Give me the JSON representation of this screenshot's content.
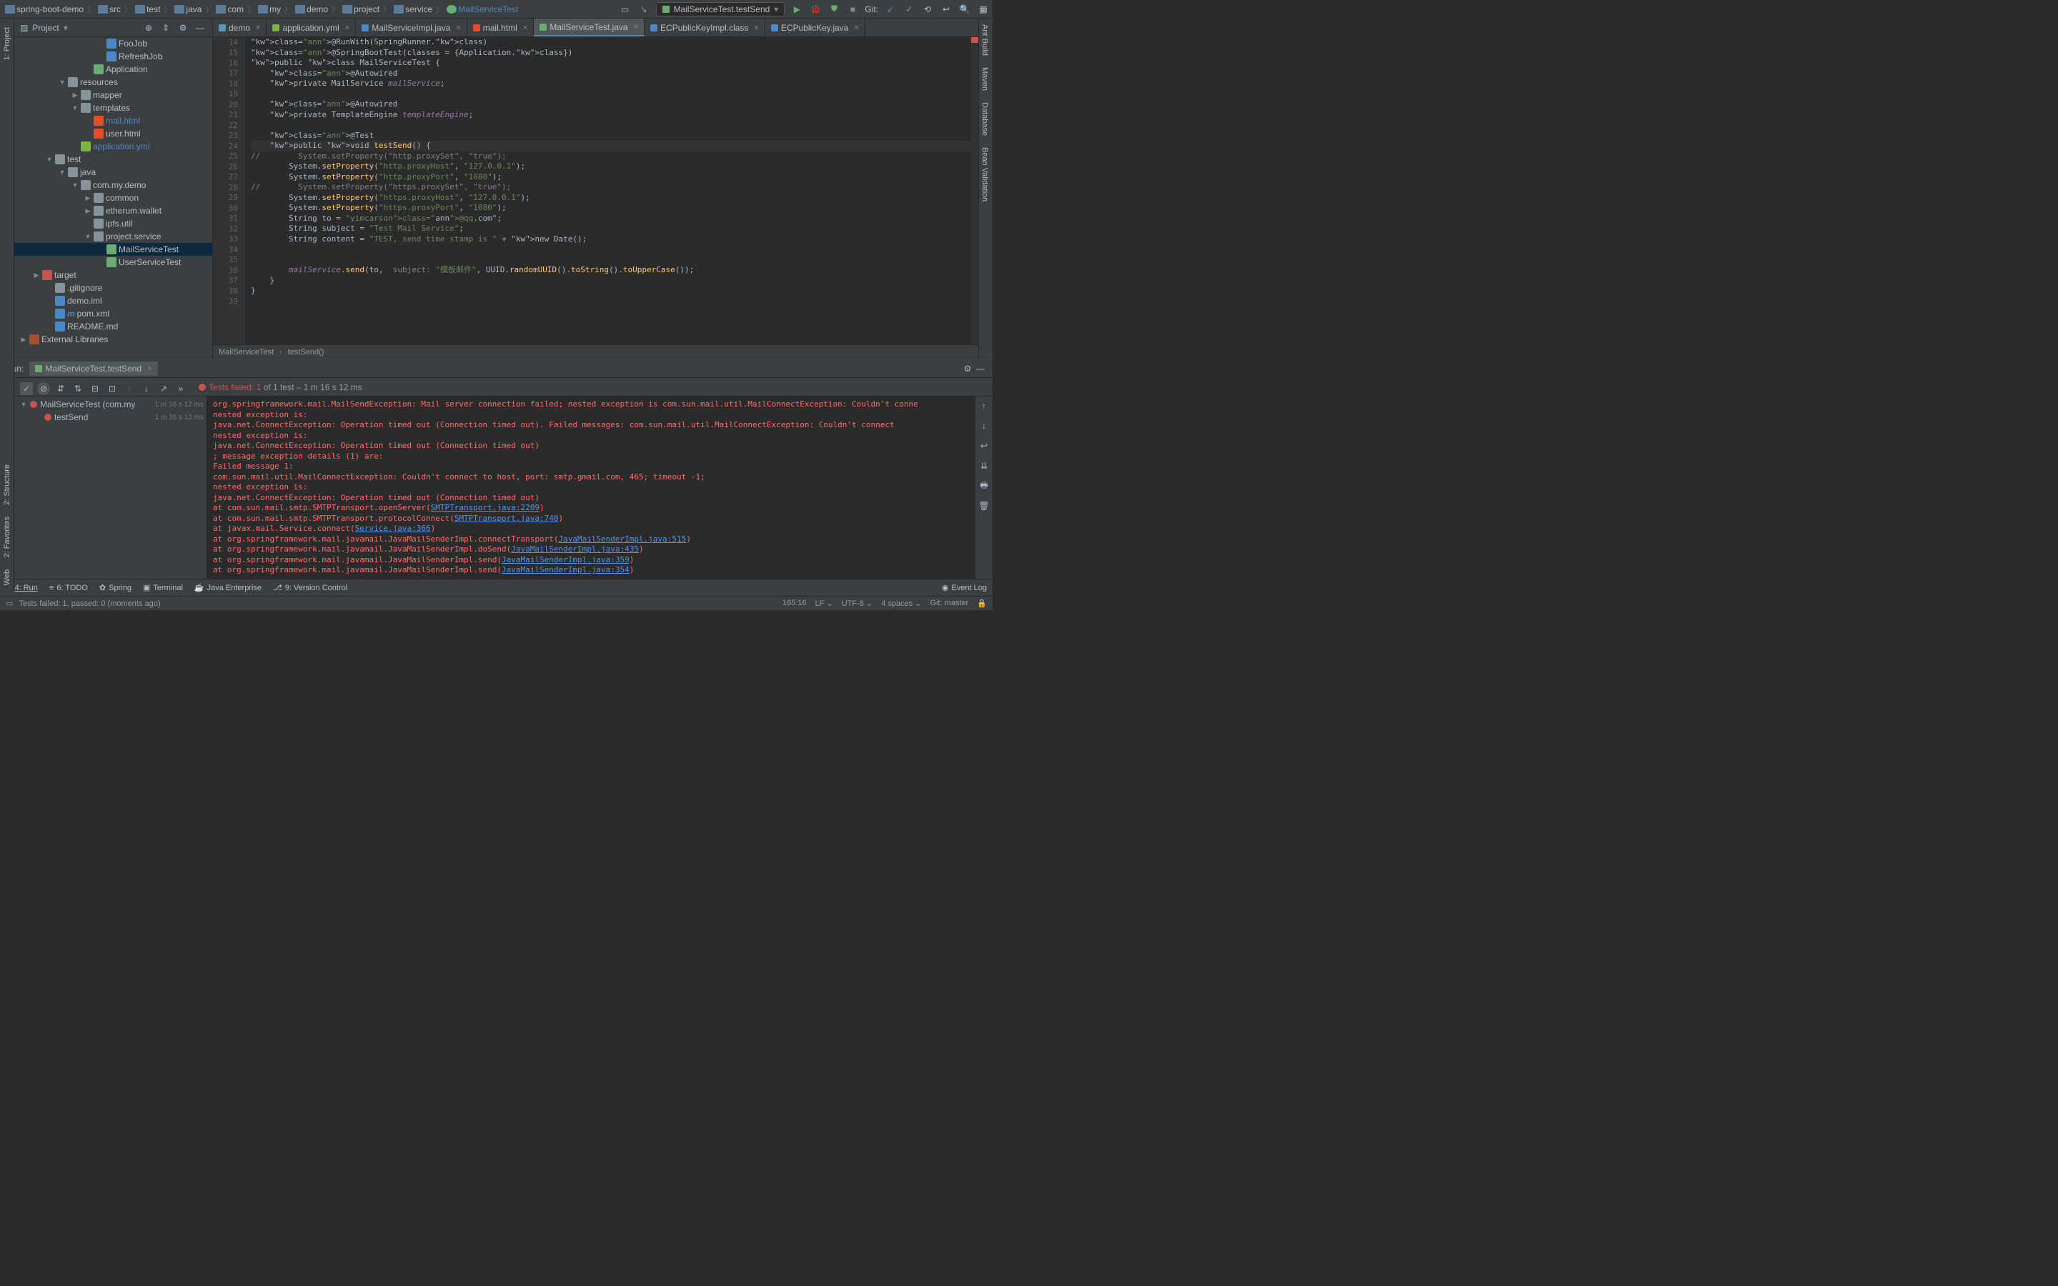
{
  "breadcrumbs": [
    "spring-boot-demo",
    "src",
    "test",
    "java",
    "com",
    "my",
    "demo",
    "project",
    "service",
    "MailServiceTest"
  ],
  "run_config": "MailServiceTest.testSend",
  "git_label": "Git:",
  "editor_tabs": [
    {
      "label": "demo",
      "icon": "#519aba"
    },
    {
      "label": "application.yml",
      "icon": "#7cb342"
    },
    {
      "label": "MailServiceImpl.java",
      "icon": "#4a88c7"
    },
    {
      "label": "mail.html",
      "icon": "#e44d26"
    },
    {
      "label": "MailServiceTest.java",
      "icon": "#6aab73",
      "active": true
    },
    {
      "label": "ECPublicKeyImpl.class",
      "icon": "#4a88c7"
    },
    {
      "label": "ECPublicKey.java",
      "icon": "#4a88c7"
    }
  ],
  "project": {
    "header": "Project",
    "items": [
      {
        "pad": 108,
        "icon": "#4a88c7",
        "label": "FooJob",
        "arr": ""
      },
      {
        "pad": 108,
        "icon": "#4a88c7",
        "label": "RefreshJob",
        "arr": ""
      },
      {
        "pad": 90,
        "icon": "#6aab73",
        "label": "Application",
        "arr": ""
      },
      {
        "pad": 54,
        "icon": "#87939a",
        "label": "resources",
        "arr": "▼"
      },
      {
        "pad": 72,
        "icon": "#87939a",
        "label": "mapper",
        "arr": "▶"
      },
      {
        "pad": 72,
        "icon": "#87939a",
        "label": "templates",
        "arr": "▼"
      },
      {
        "pad": 90,
        "icon": "#e44d26",
        "label": "mail.html",
        "arr": "",
        "color": "#4a88c7"
      },
      {
        "pad": 90,
        "icon": "#e44d26",
        "label": "user.html",
        "arr": ""
      },
      {
        "pad": 72,
        "icon": "#7cb342",
        "label": "application.yml",
        "arr": "",
        "color": "#4a88c7"
      },
      {
        "pad": 36,
        "icon": "#87939a",
        "label": "test",
        "arr": "▼"
      },
      {
        "pad": 54,
        "icon": "#87939a",
        "label": "java",
        "arr": "▼"
      },
      {
        "pad": 72,
        "icon": "#87939a",
        "label": "com.my.demo",
        "arr": "▼"
      },
      {
        "pad": 90,
        "icon": "#87939a",
        "label": "common",
        "arr": "▶"
      },
      {
        "pad": 90,
        "icon": "#87939a",
        "label": "etherum.wallet",
        "arr": "▶"
      },
      {
        "pad": 90,
        "icon": "#87939a",
        "label": "ipfs.util",
        "arr": ""
      },
      {
        "pad": 90,
        "icon": "#87939a",
        "label": "project.service",
        "arr": "▼"
      },
      {
        "pad": 108,
        "icon": "#6aab73",
        "label": "MailServiceTest",
        "arr": "",
        "sel": true
      },
      {
        "pad": 108,
        "icon": "#6aab73",
        "label": "UserServiceTest",
        "arr": ""
      },
      {
        "pad": 18,
        "icon": "#c75450",
        "label": "target",
        "arr": "▶"
      },
      {
        "pad": 36,
        "icon": "#87939a",
        "label": ".gitignore",
        "arr": ""
      },
      {
        "pad": 36,
        "icon": "#4a88c7",
        "label": "demo.iml",
        "arr": ""
      },
      {
        "pad": 36,
        "icon": "#4a88c7",
        "label": "pom.xml",
        "arr": "",
        "pre": "m"
      },
      {
        "pad": 36,
        "icon": "#4a88c7",
        "label": "README.md",
        "arr": ""
      },
      {
        "pad": 0,
        "icon": "#a0522d",
        "label": "External Libraries",
        "arr": "▶"
      }
    ]
  },
  "code": {
    "start": 14,
    "highlight": 24,
    "lines": [
      "@RunWith(SpringRunner.class)",
      "@SpringBootTest(classes = {Application.class})",
      "public class MailServiceTest {",
      "    @Autowired",
      "    private MailService mailService;",
      "",
      "    @Autowired",
      "    private TemplateEngine templateEngine;",
      "",
      "    @Test",
      "    public void testSend() {",
      "//        System.setProperty(\"http.proxySet\", \"true\");",
      "        System.setProperty(\"http.proxyHost\", \"127.0.0.1\");",
      "        System.setProperty(\"http.proxyPort\", \"1080\");",
      "//        System.setProperty(\"https.proxySet\", \"true\");",
      "        System.setProperty(\"https.proxyHost\", \"127.0.0.1\");",
      "        System.setProperty(\"https.proxyPort\", \"1080\");",
      "        String to = \"yimcarson@qq.com\";",
      "        String subject = \"Test Mail Service\";",
      "        String content = \"TEST, send time stamp is \" + new Date();",
      "",
      "",
      "        mailService.send(to,  subject: \"模板邮件\", UUID.randomUUID().toString().toUpperCase());",
      "    }",
      "}",
      ""
    ]
  },
  "crumb": {
    "cls": "MailServiceTest",
    "method": "testSend()"
  },
  "run": {
    "title": "Run:",
    "tab": "MailServiceTest.testSend",
    "fail_header_pre": "Tests failed: 1",
    "fail_header_post": " of 1 test – 1 m 16 s 12 ms",
    "tree": [
      {
        "label": "MailServiceTest (com.my",
        "time": "1 m 16 s 12 ms",
        "arr": "▼",
        "err": true
      },
      {
        "label": "testSend",
        "time": "1 m 16 s 12 ms",
        "arr": "",
        "err": true,
        "pad": 20
      }
    ],
    "console": [
      "",
      "org.springframework.mail.MailSendException: Mail server connection failed; nested exception is com.sun.mail.util.MailConnectException: Couldn't conne",
      "  nested exception is:",
      "\tjava.net.ConnectException: Operation timed out (Connection timed out). Failed messages: com.sun.mail.util.MailConnectException: Couldn't connect",
      "  nested exception is:",
      "\tjava.net.ConnectException: Operation timed out (Connection timed out)",
      "; message exception details (1) are:",
      "Failed message 1:",
      "com.sun.mail.util.MailConnectException: Couldn't connect to host, port: smtp.gmail.com, 465; timeout -1;",
      "  nested exception is:",
      "\tjava.net.ConnectException: Operation timed out (Connection timed out)",
      "\tat com.sun.mail.smtp.SMTPTransport.openServer(|SMTPTransport.java:2209|)",
      "\tat com.sun.mail.smtp.SMTPTransport.protocolConnect(|SMTPTransport.java:740|)",
      "\tat javax.mail.Service.connect(|Service.java:366|)",
      "\tat org.springframework.mail.javamail.JavaMailSenderImpl.connectTransport(|JavaMailSenderImpl.java:515|)",
      "\tat org.springframework.mail.javamail.JavaMailSenderImpl.doSend(|JavaMailSenderImpl.java:435|)",
      "\tat org.springframework.mail.javamail.JavaMailSenderImpl.send(|JavaMailSenderImpl.java:359|)",
      "\tat org.springframework.mail.javamail.JavaMailSenderImpl.send(|JavaMailSenderImpl.java:354|)"
    ]
  },
  "bottom": {
    "run": "4: Run",
    "todo": "6: TODO",
    "spring": "Spring",
    "terminal": "Terminal",
    "je": "Java Enterprise",
    "vc": "9: Version Control",
    "event": "Event Log"
  },
  "status": {
    "msg": "Tests failed: 1, passed: 0 (moments ago)",
    "pos": "165:16",
    "lf": "LF",
    "enc": "UTF-8",
    "indent": "4 spaces",
    "branch": "Git: master"
  },
  "left_labels": [
    "1: Project"
  ],
  "right_labels": [
    "Ant Build",
    "Maven",
    "Database",
    "Bean Validation"
  ],
  "side_labels": [
    "2: Structure",
    "2: Favorites",
    "Web"
  ]
}
